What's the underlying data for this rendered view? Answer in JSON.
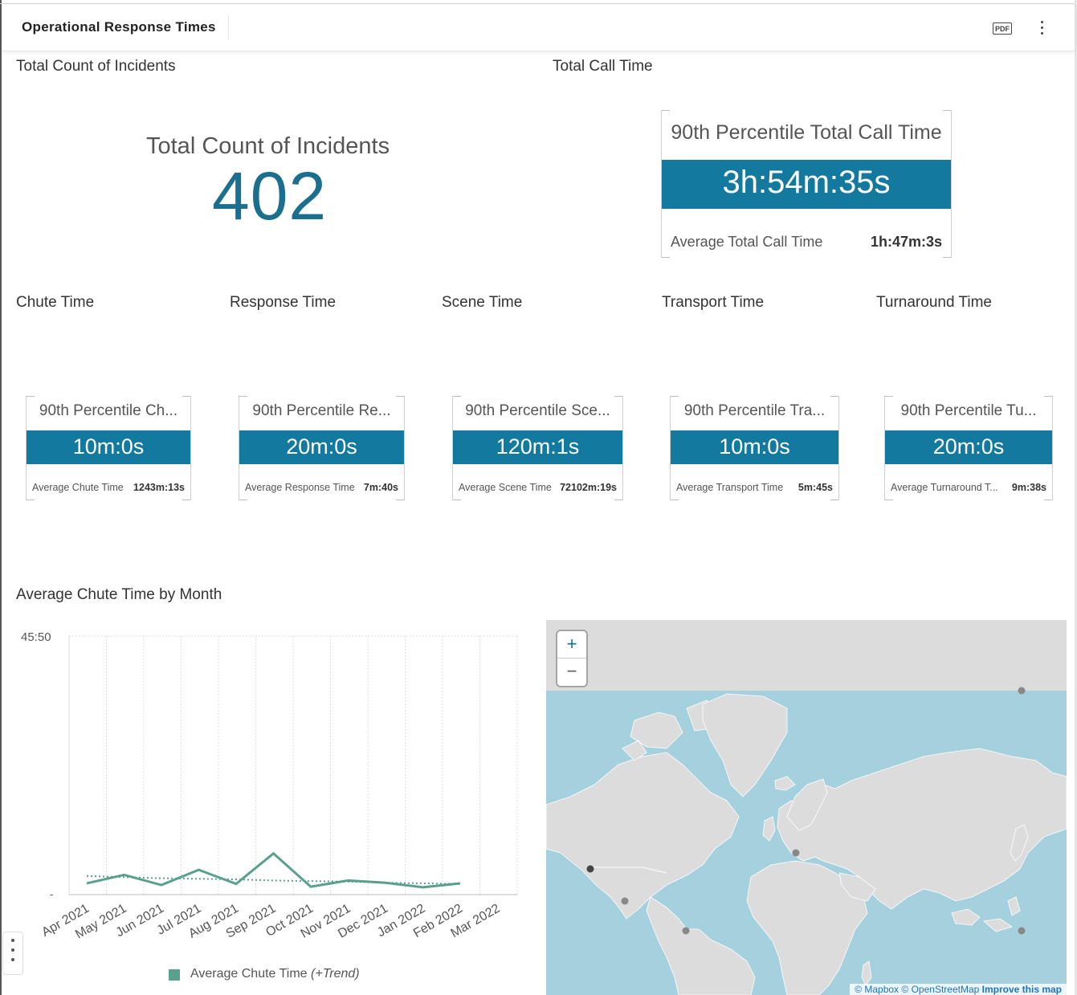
{
  "header": {
    "title": "Operational Response Times",
    "pdf_label": "PDF"
  },
  "sections": {
    "incidents": "Total Count of Incidents",
    "call_time": "Total Call Time",
    "chute": "Chute Time",
    "response": "Response Time",
    "scene": "Scene Time",
    "transport": "Transport Time",
    "turnaround": "Turnaround Time",
    "chart": "Average Chute Time by Month"
  },
  "incidents_kpi": {
    "label": "Total Count of Incidents",
    "value": "402"
  },
  "call_time_card": {
    "head": "90th Percentile Total Call Time",
    "value": "3h:54m:35s",
    "foot_label": "Average Total Call Time",
    "foot_value": "1h:47m:3s"
  },
  "cards": [
    {
      "head": "90th Percentile Ch...",
      "value": "10m:0s",
      "foot_label": "Average Chute Time",
      "foot_value": "1243m:13s"
    },
    {
      "head": "90th Percentile Re...",
      "value": "20m:0s",
      "foot_label": "Average Response Time",
      "foot_value": "7m:40s"
    },
    {
      "head": "90th Percentile Sce...",
      "value": "120m:1s",
      "foot_label": "Average Scene Time",
      "foot_value": "72102m:19s"
    },
    {
      "head": "90th Percentile Tra...",
      "value": "10m:0s",
      "foot_label": "Average Transport Time",
      "foot_value": "5m:45s"
    },
    {
      "head": "90th Percentile Tu...",
      "value": "20m:0s",
      "foot_label": "Average Turnaround T...",
      "foot_value": "9m:38s"
    }
  ],
  "chart_data": {
    "type": "line",
    "title": "Average Chute Time by Month",
    "x": [
      "Apr 2021",
      "May 2021",
      "Jun 2021",
      "Jul 2021",
      "Aug 2021",
      "Sep 2021",
      "Oct 2021",
      "Nov 2021",
      "Dec 2021",
      "Jan 2022",
      "Feb 2022",
      "Mar 2022"
    ],
    "ytick_top": "45:50",
    "ytick_bottom": "-",
    "ylim_minutes": [
      0,
      45.83
    ],
    "series": [
      {
        "name": "Average Chute Time",
        "color": "#5aa08e",
        "values_minutes": [
          2.0,
          3.5,
          1.7,
          4.4,
          1.9,
          7.3,
          1.4,
          2.5,
          2.1,
          1.3,
          2.0,
          null
        ]
      },
      {
        "name": "(+Trend)",
        "color": "#5aa08e",
        "dashed": true,
        "values_minutes": [
          3.3,
          3.1,
          2.9,
          2.8,
          2.7,
          2.5,
          2.4,
          2.3,
          2.1,
          2.0,
          1.9,
          null
        ]
      }
    ],
    "legend": {
      "label": "Average Chute Time",
      "suffix": "(+Trend)",
      "position": "bottom"
    },
    "grid": true
  },
  "map": {
    "zoom_in": "+",
    "zoom_out": "−",
    "attribution": {
      "mapbox": "© Mapbox",
      "osm": "© OpenStreetMap",
      "improve": "Improve this map"
    },
    "ocean_color": "#a5d0de",
    "land_color": "#dcdcdc"
  }
}
